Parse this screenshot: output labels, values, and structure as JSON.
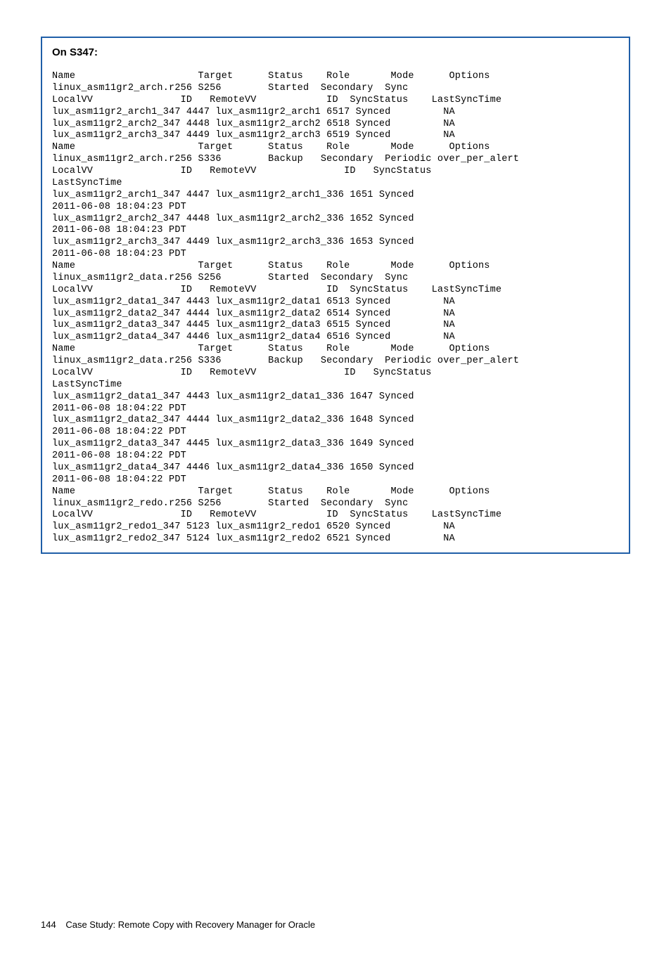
{
  "box": {
    "title": "On S347:"
  },
  "terminal": {
    "lines": "Name                     Target      Status    Role       Mode      Options\nlinux_asm11gr2_arch.r256 S256        Started  Secondary  Sync\nLocalVV               ID   RemoteVV            ID  SyncStatus    LastSyncTime\nlux_asm11gr2_arch1_347 4447 lux_asm11gr2_arch1 6517 Synced         NA\nlux_asm11gr2_arch2_347 4448 lux_asm11gr2_arch2 6518 Synced         NA\nlux_asm11gr2_arch3_347 4449 lux_asm11gr2_arch3 6519 Synced         NA\nName                     Target      Status    Role       Mode      Options\nlinux_asm11gr2_arch.r256 S336        Backup   Secondary  Periodic over_per_alert\nLocalVV               ID   RemoteVV               ID   SyncStatus\nLastSyncTime\nlux_asm11gr2_arch1_347 4447 lux_asm11gr2_arch1_336 1651 Synced\n2011-06-08 18:04:23 PDT\nlux_asm11gr2_arch2_347 4448 lux_asm11gr2_arch2_336 1652 Synced\n2011-06-08 18:04:23 PDT\nlux_asm11gr2_arch3_347 4449 lux_asm11gr2_arch3_336 1653 Synced\n2011-06-08 18:04:23 PDT\nName                     Target      Status    Role       Mode      Options\nlinux_asm11gr2_data.r256 S256        Started  Secondary  Sync\nLocalVV               ID   RemoteVV            ID  SyncStatus    LastSyncTime\nlux_asm11gr2_data1_347 4443 lux_asm11gr2_data1 6513 Synced         NA\nlux_asm11gr2_data2_347 4444 lux_asm11gr2_data2 6514 Synced         NA\nlux_asm11gr2_data3_347 4445 lux_asm11gr2_data3 6515 Synced         NA\nlux_asm11gr2_data4_347 4446 lux_asm11gr2_data4 6516 Synced         NA\nName                     Target      Status    Role       Mode      Options\nlinux_asm11gr2_data.r256 S336        Backup   Secondary  Periodic over_per_alert\nLocalVV               ID   RemoteVV               ID   SyncStatus\nLastSyncTime\nlux_asm11gr2_data1_347 4443 lux_asm11gr2_data1_336 1647 Synced\n2011-06-08 18:04:22 PDT\nlux_asm11gr2_data2_347 4444 lux_asm11gr2_data2_336 1648 Synced\n2011-06-08 18:04:22 PDT\nlux_asm11gr2_data3_347 4445 lux_asm11gr2_data3_336 1649 Synced\n2011-06-08 18:04:22 PDT\nlux_asm11gr2_data4_347 4446 lux_asm11gr2_data4_336 1650 Synced\n2011-06-08 18:04:22 PDT\nName                     Target      Status    Role       Mode      Options\nlinux_asm11gr2_redo.r256 S256        Started  Secondary  Sync\nLocalVV               ID   RemoteVV            ID  SyncStatus    LastSyncTime\nlux_asm11gr2_redo1_347 5123 lux_asm11gr2_redo1 6520 Synced         NA\nlux_asm11gr2_redo2_347 5124 lux_asm11gr2_redo2 6521 Synced         NA"
  },
  "footer": {
    "page_number": "144",
    "title": "Case Study: Remote Copy with Recovery Manager for Oracle"
  }
}
